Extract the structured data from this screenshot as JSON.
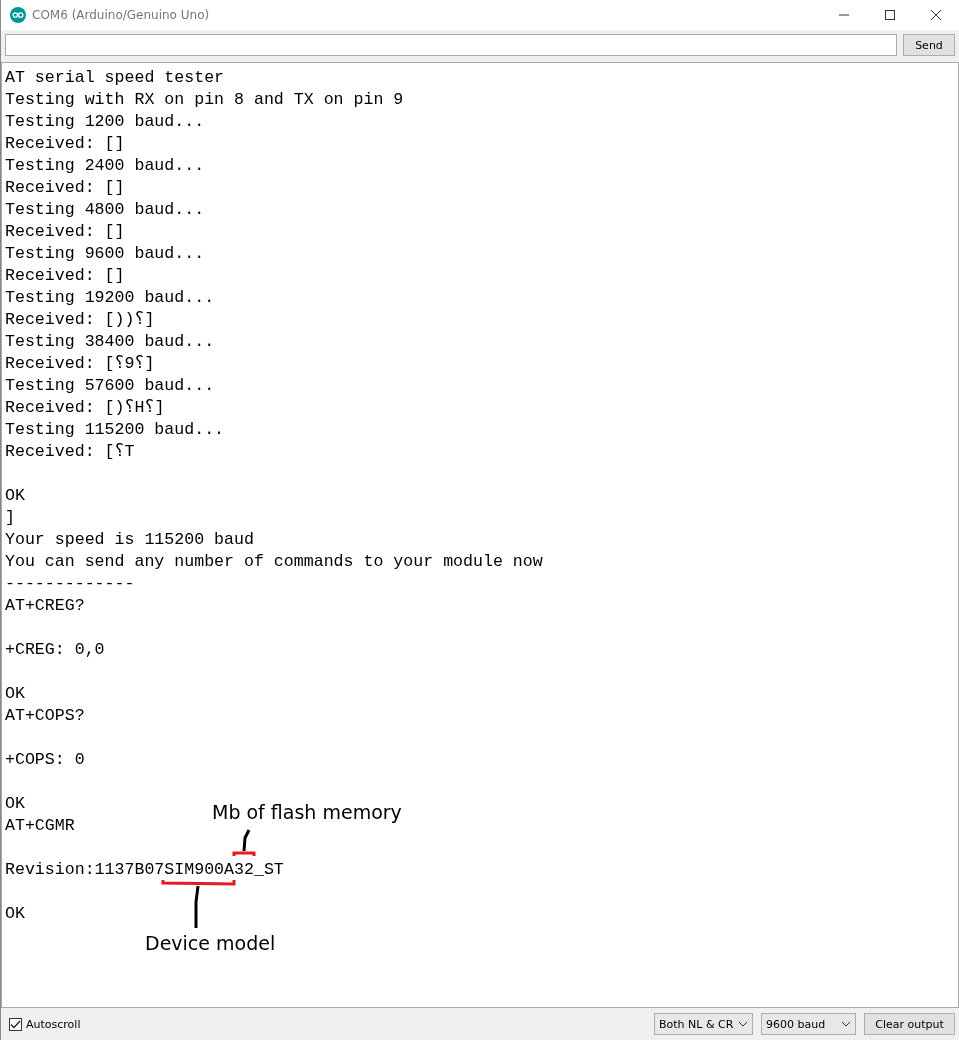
{
  "window": {
    "title": "COM6 (Arduino/Genuino Uno)"
  },
  "send_bar": {
    "button": "Send"
  },
  "output": [
    {
      "kind": "text",
      "text": "AT serial speed tester"
    },
    {
      "kind": "text",
      "text": "Testing with RX on pin 8 and TX on pin 9"
    },
    {
      "kind": "text",
      "text": "Testing 1200 baud..."
    },
    {
      "kind": "text",
      "text": "Received: []"
    },
    {
      "kind": "text",
      "text": "Testing 2400 baud..."
    },
    {
      "kind": "text",
      "text": "Received: []"
    },
    {
      "kind": "text",
      "text": "Testing 4800 baud..."
    },
    {
      "kind": "text",
      "text": "Received: []"
    },
    {
      "kind": "text",
      "text": "Testing 9600 baud..."
    },
    {
      "kind": "text",
      "text": "Received: []"
    },
    {
      "kind": "text",
      "text": "Testing 19200 baud..."
    },
    {
      "kind": "text",
      "text": "Received: [))؟]"
    },
    {
      "kind": "text",
      "text": "Testing 38400 baud..."
    },
    {
      "kind": "text",
      "text": "Received: [؟9؟]"
    },
    {
      "kind": "text",
      "text": "Testing 57600 baud..."
    },
    {
      "kind": "text",
      "text": "Received: [)؟H؟]"
    },
    {
      "kind": "text",
      "text": "Testing 115200 baud..."
    },
    {
      "kind": "text",
      "text": "Received: [؟T"
    },
    {
      "kind": "blank"
    },
    {
      "kind": "text",
      "text": "OK"
    },
    {
      "kind": "text",
      "text": "]"
    },
    {
      "kind": "text",
      "text": "Your speed is 115200 baud"
    },
    {
      "kind": "text",
      "text": "You can send any number of commands to your module now"
    },
    {
      "kind": "text",
      "text": "-------------"
    },
    {
      "kind": "text",
      "text": "AT+CREG?"
    },
    {
      "kind": "blank"
    },
    {
      "kind": "text",
      "text": "+CREG: 0,0"
    },
    {
      "kind": "blank"
    },
    {
      "kind": "text",
      "text": "OK"
    },
    {
      "kind": "text",
      "text": "AT+COPS?"
    },
    {
      "kind": "blank"
    },
    {
      "kind": "text",
      "text": "+COPS: 0"
    },
    {
      "kind": "blank"
    },
    {
      "kind": "text",
      "text": "OK"
    },
    {
      "kind": "text",
      "text": "AT+CGMR"
    },
    {
      "kind": "blank"
    },
    {
      "kind": "text",
      "text": "Revision:1137B07SIM900A32_ST"
    },
    {
      "kind": "blank"
    },
    {
      "kind": "text",
      "text": "OK"
    }
  ],
  "annotations": [
    {
      "text": "Mb of flash memory"
    },
    {
      "text": "Device model"
    }
  ],
  "footer": {
    "autoscroll": {
      "label": "Autoscroll",
      "checked": true
    },
    "line_ending": "Both NL & CR",
    "baud_rate": "9600 baud",
    "clear_button": "Clear output"
  }
}
